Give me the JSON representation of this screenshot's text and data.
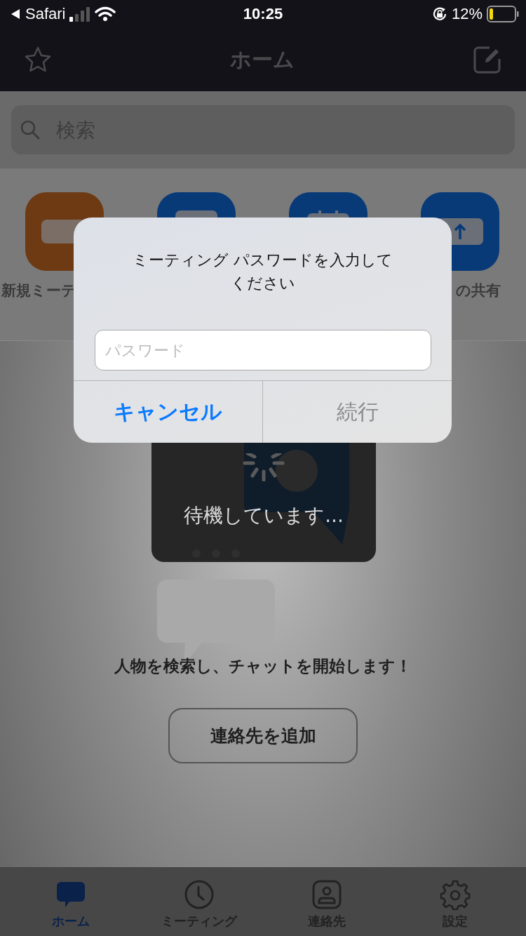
{
  "status_bar": {
    "back_label": "Safari",
    "time": "10:25",
    "battery": "12%"
  },
  "nav": {
    "title": "ホーム"
  },
  "search": {
    "placeholder": "検索"
  },
  "actions": [
    {
      "kind": "video",
      "label": "新規ミーテ",
      "color": "#6e3a14"
    },
    {
      "kind": "plus",
      "color": "#083a78"
    },
    {
      "kind": "calendar",
      "color": "#083a78"
    },
    {
      "kind": "share",
      "label": "の共有",
      "color": "#083a78"
    }
  ],
  "empty_state": {
    "message": "人物を検索し、チャットを開始します！",
    "button": "連絡先を追加"
  },
  "loading": {
    "text": "待機しています..."
  },
  "dialog": {
    "title": "ミーティング パスワードを入力してください",
    "placeholder": "パスワード",
    "buttons": [
      {
        "label": "キャンセル",
        "disabled": false
      },
      {
        "label": "続行",
        "disabled": true
      }
    ]
  },
  "tabs": [
    {
      "kind": "home",
      "label": "ホーム",
      "selected": true
    },
    {
      "kind": "meetings",
      "label": "ミーティング",
      "selected": false
    },
    {
      "kind": "contacts",
      "label": "連絡先",
      "selected": false
    },
    {
      "kind": "settings",
      "label": "設定",
      "selected": false
    }
  ]
}
